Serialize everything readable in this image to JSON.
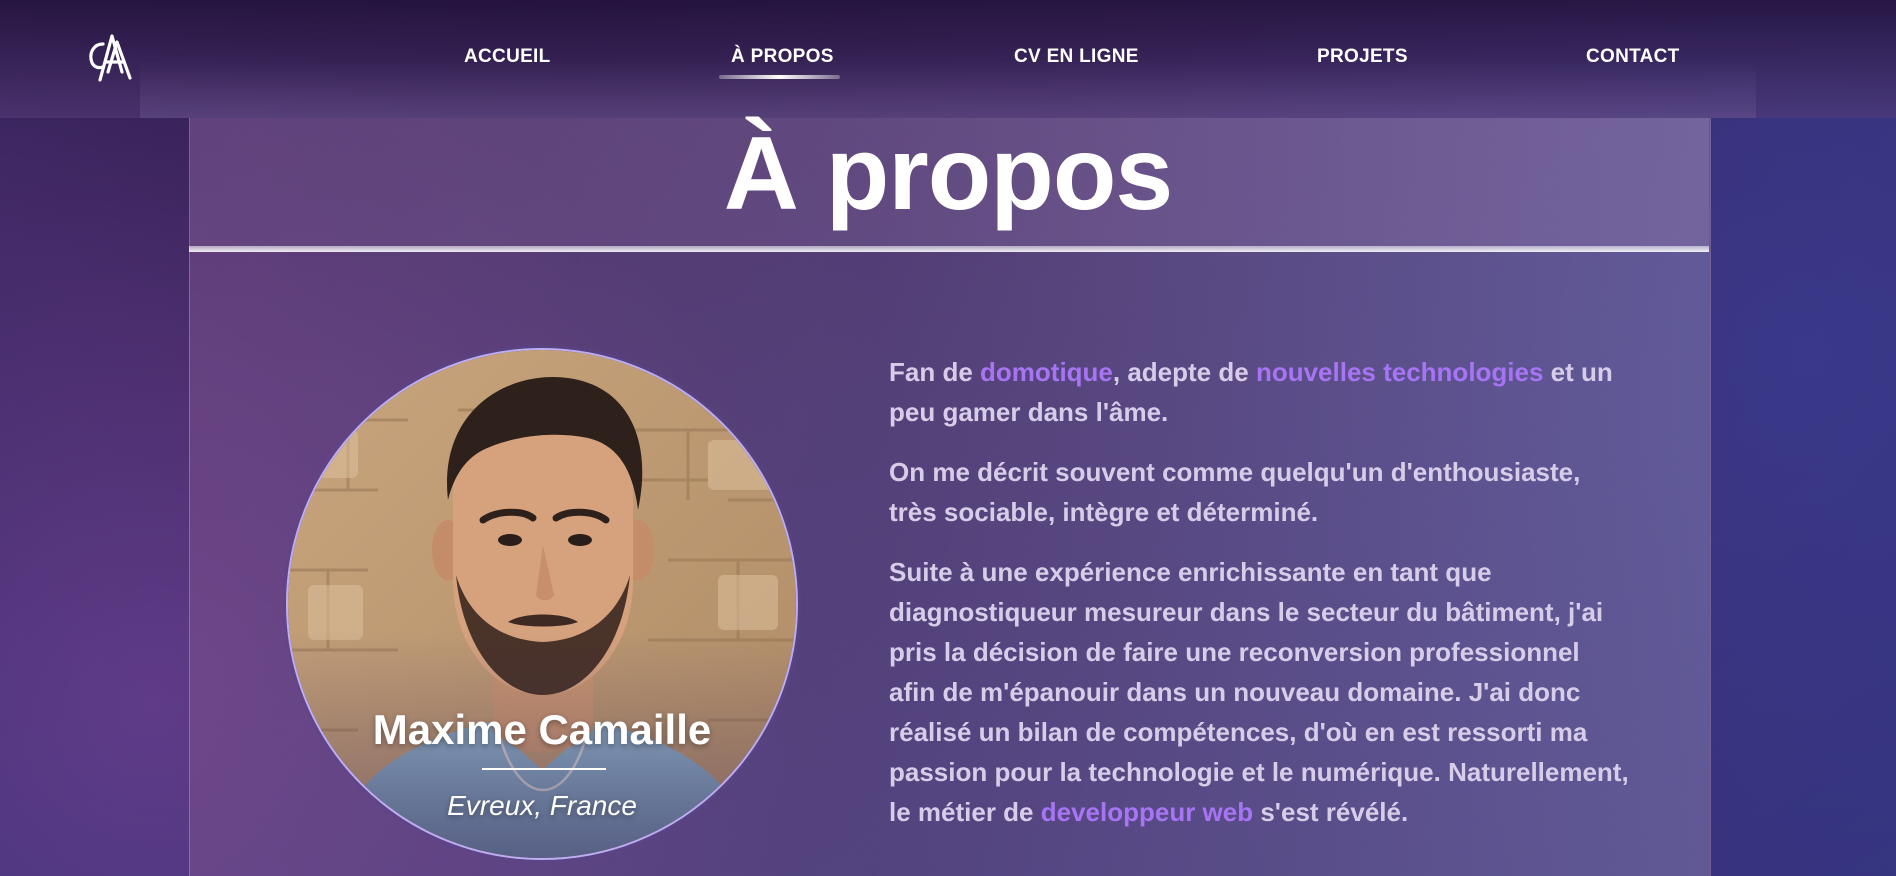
{
  "header": {
    "logo_text": "CMA",
    "nav": [
      {
        "label": "ACCUEIL",
        "active": false
      },
      {
        "label": "À PROPOS",
        "active": true
      },
      {
        "label": "CV EN LIGNE",
        "active": false
      },
      {
        "label": "PROJETS",
        "active": false
      },
      {
        "label": "CONTACT",
        "active": false
      }
    ]
  },
  "main": {
    "title": "À propos",
    "profile": {
      "name": "Maxime Camaille",
      "location": "Evreux, France"
    },
    "paragraphs": {
      "p1": {
        "a": "Fan de ",
        "b": "domotique",
        "c": ", adepte de ",
        "d": "nouvelles technologies",
        "e": " et un peu gamer dans l'âme."
      },
      "p2": "On me décrit souvent comme quelqu'un d'enthousiaste, très sociable, intègre et déterminé.",
      "p3": {
        "a": "Suite à une expérience enrichissante en tant que diagnostiqueur mesureur dans le secteur du bâtiment, j'ai pris la décision de faire une reconversion professionnel afin de m'épanouir dans un nouveau domaine. J'ai donc réalisé un bilan de compétences, d'où en est ressorti ma passion pour la technologie et le numérique. Naturellement, le métier de ",
        "b": "developpeur web",
        "c": " s'est révélé."
      }
    }
  },
  "colors": {
    "accent": "#a774f4",
    "body_text": "#d8cde8",
    "background": "#35327a"
  }
}
